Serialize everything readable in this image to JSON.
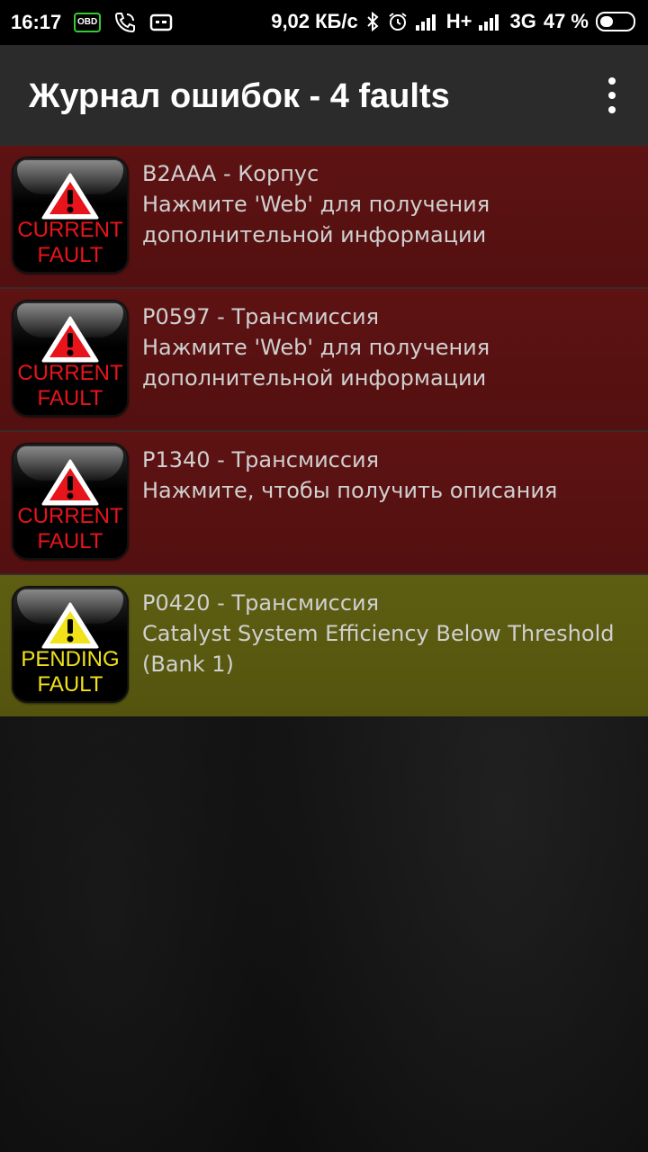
{
  "status_bar": {
    "time": "16:17",
    "obd_chip": "OBD",
    "net_speed": "9,02 КБ/с",
    "net1": "H+",
    "net2": "3G",
    "battery": "47 %",
    "battery_level": 0.47
  },
  "appbar": {
    "title": "Журнал ошибок - 4 faults"
  },
  "faults": [
    {
      "badge_line1": "CURRENT",
      "badge_line2": "FAULT",
      "code": "B2AAA - Корпус",
      "desc": "Нажмите 'Web' для получения дополнительной информации",
      "kind": "current"
    },
    {
      "badge_line1": "CURRENT",
      "badge_line2": "FAULT",
      "code": "P0597 - Трансмиссия",
      "desc": "Нажмите 'Web' для получения дополнительной информации",
      "kind": "current"
    },
    {
      "badge_line1": "CURRENT",
      "badge_line2": "FAULT",
      "code": "P1340 - Трансмиссия",
      "desc": "Нажмите, чтобы получить описания",
      "kind": "current"
    },
    {
      "badge_line1": "PENDING",
      "badge_line2": "FAULT",
      "code": "P0420 - Трансмиссия",
      "desc": "Catalyst System Efficiency Below Threshold (Bank 1)",
      "kind": "pending"
    }
  ],
  "colors": {
    "current_bg": "#5e1212",
    "pending_bg": "#5e5e12",
    "current_text": "#e8141b",
    "pending_text": "#f2e21a"
  }
}
